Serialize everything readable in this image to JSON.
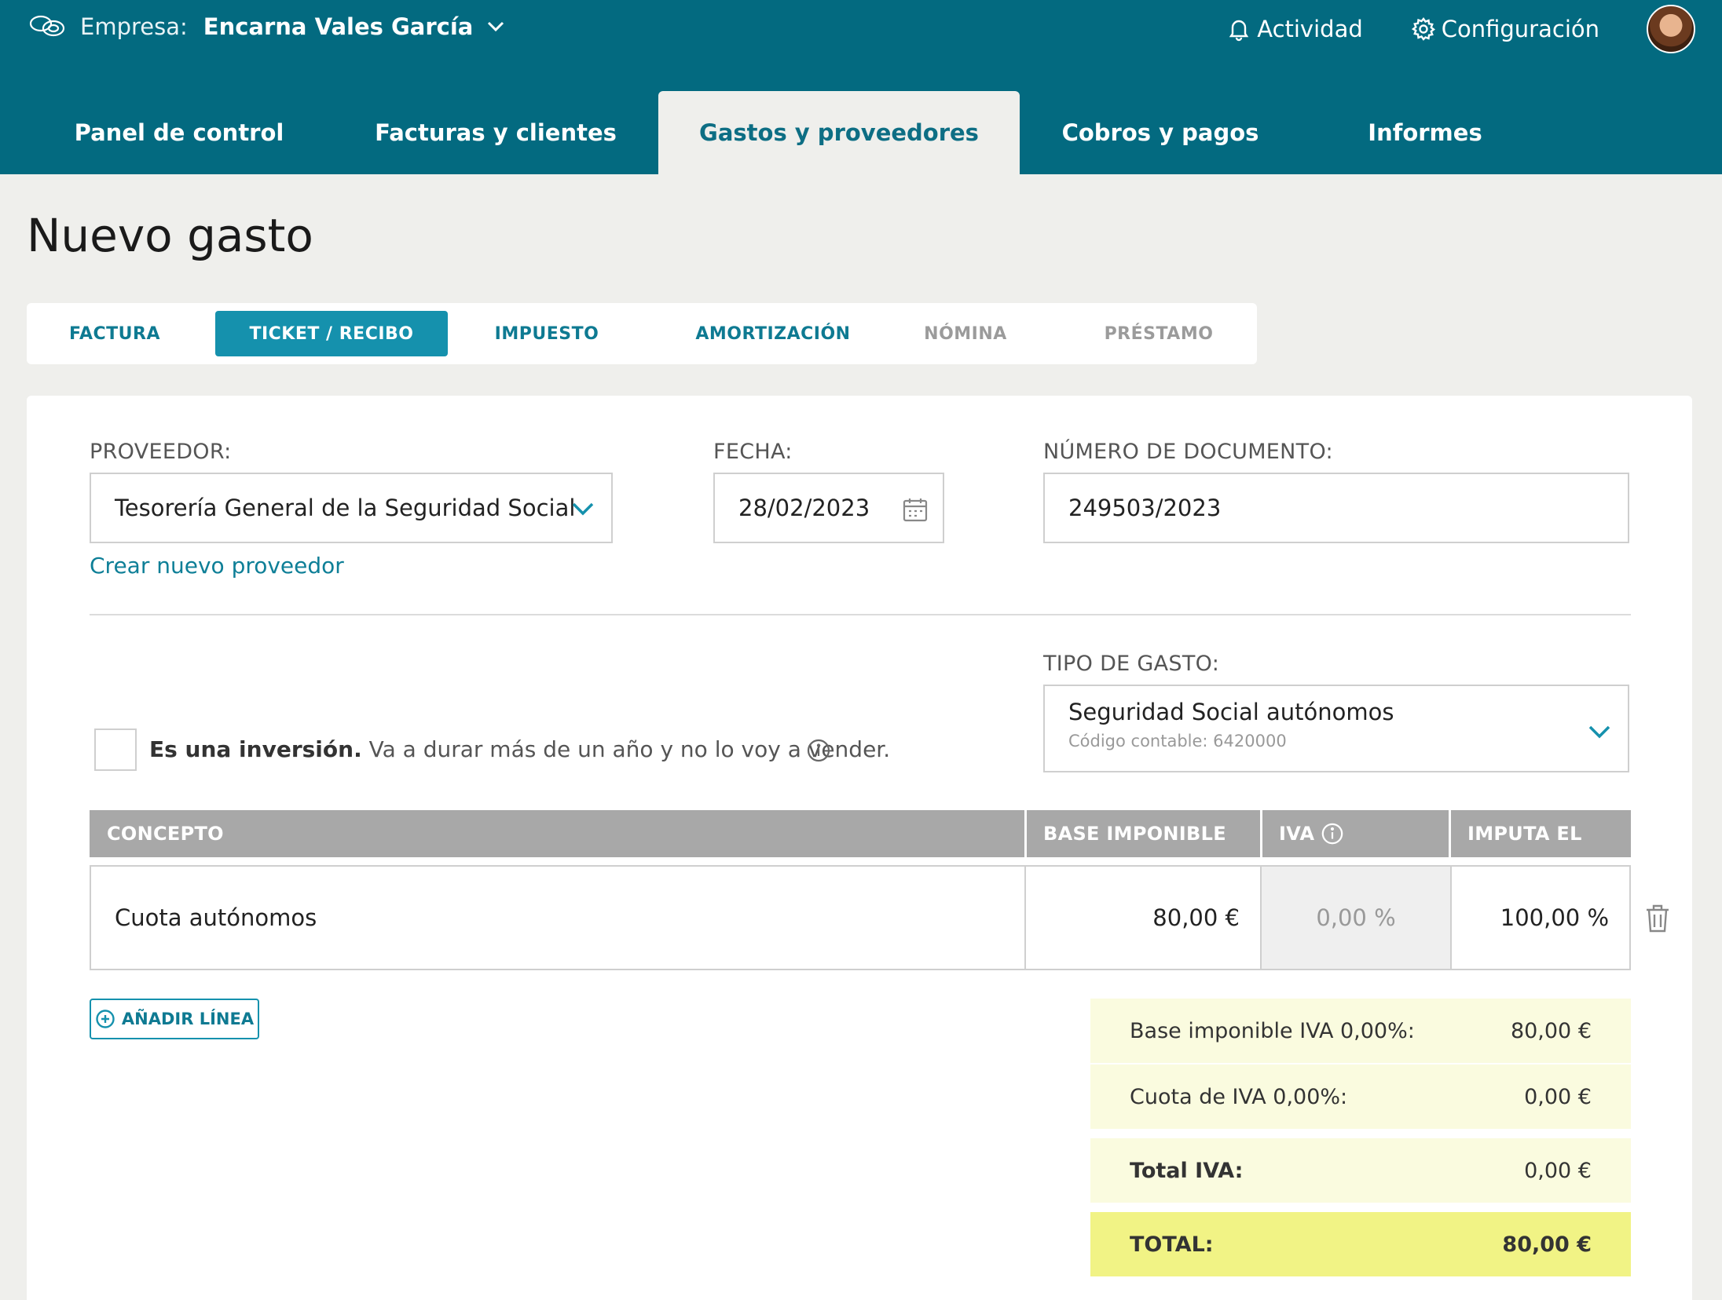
{
  "header": {
    "company_label": "Empresa:",
    "company_name": "Encarna Vales García",
    "activity": "Actividad",
    "settings": "Configuración"
  },
  "nav": {
    "tabs": [
      "Panel de control",
      "Facturas y clientes",
      "Gastos y proveedores",
      "Cobros y pagos",
      "Informes"
    ],
    "active": "Gastos y proveedores"
  },
  "page": {
    "title": "Nuevo gasto"
  },
  "type_tabs": {
    "items": [
      "FACTURA",
      "TICKET / RECIBO",
      "IMPUESTO",
      "AMORTIZACIÓN",
      "NÓMINA",
      "PRÉSTAMO"
    ],
    "active": "TICKET / RECIBO",
    "disabled": [
      "NÓMINA",
      "PRÉSTAMO"
    ]
  },
  "form": {
    "provider_label": "PROVEEDOR:",
    "provider_value": "Tesorería General de la Seguridad Social",
    "create_provider": "Crear nuevo proveedor",
    "date_label": "FECHA:",
    "date_value": "28/02/2023",
    "doc_label": "NÚMERO DE DOCUMENTO:",
    "doc_value": "249503/2023",
    "expense_type_label": "TIPO DE GASTO:",
    "expense_type_value": "Seguridad Social autónomos",
    "expense_type_code": "Código contable: 6420000",
    "investment_bold": "Es una inversión.",
    "investment_text": "Va a durar más de un año y no lo voy a vender."
  },
  "table": {
    "headers": {
      "concept": "CONCEPTO",
      "base": "BASE IMPONIBLE",
      "iva": "IVA",
      "imputa": "IMPUTA EL"
    },
    "rows": [
      {
        "concept": "Cuota autónomos",
        "base": "80,00 €",
        "iva": "0,00 %",
        "imputa": "100,00 %"
      }
    ],
    "add_line": "AÑADIR LÍNEA"
  },
  "summary": {
    "base_label": "Base imponible IVA 0,00%:",
    "base_value": "80,00 €",
    "cuota_label": "Cuota de IVA 0,00%:",
    "cuota_value": "0,00 €",
    "total_iva_label": "Total IVA:",
    "total_iva_value": "0,00 €",
    "total_label": "TOTAL:",
    "total_value": "80,00 €"
  },
  "colors": {
    "brand": "#036a80",
    "accent": "#1591ad",
    "total_bg": "#f1f385",
    "summary_bg": "#fafbdf"
  }
}
